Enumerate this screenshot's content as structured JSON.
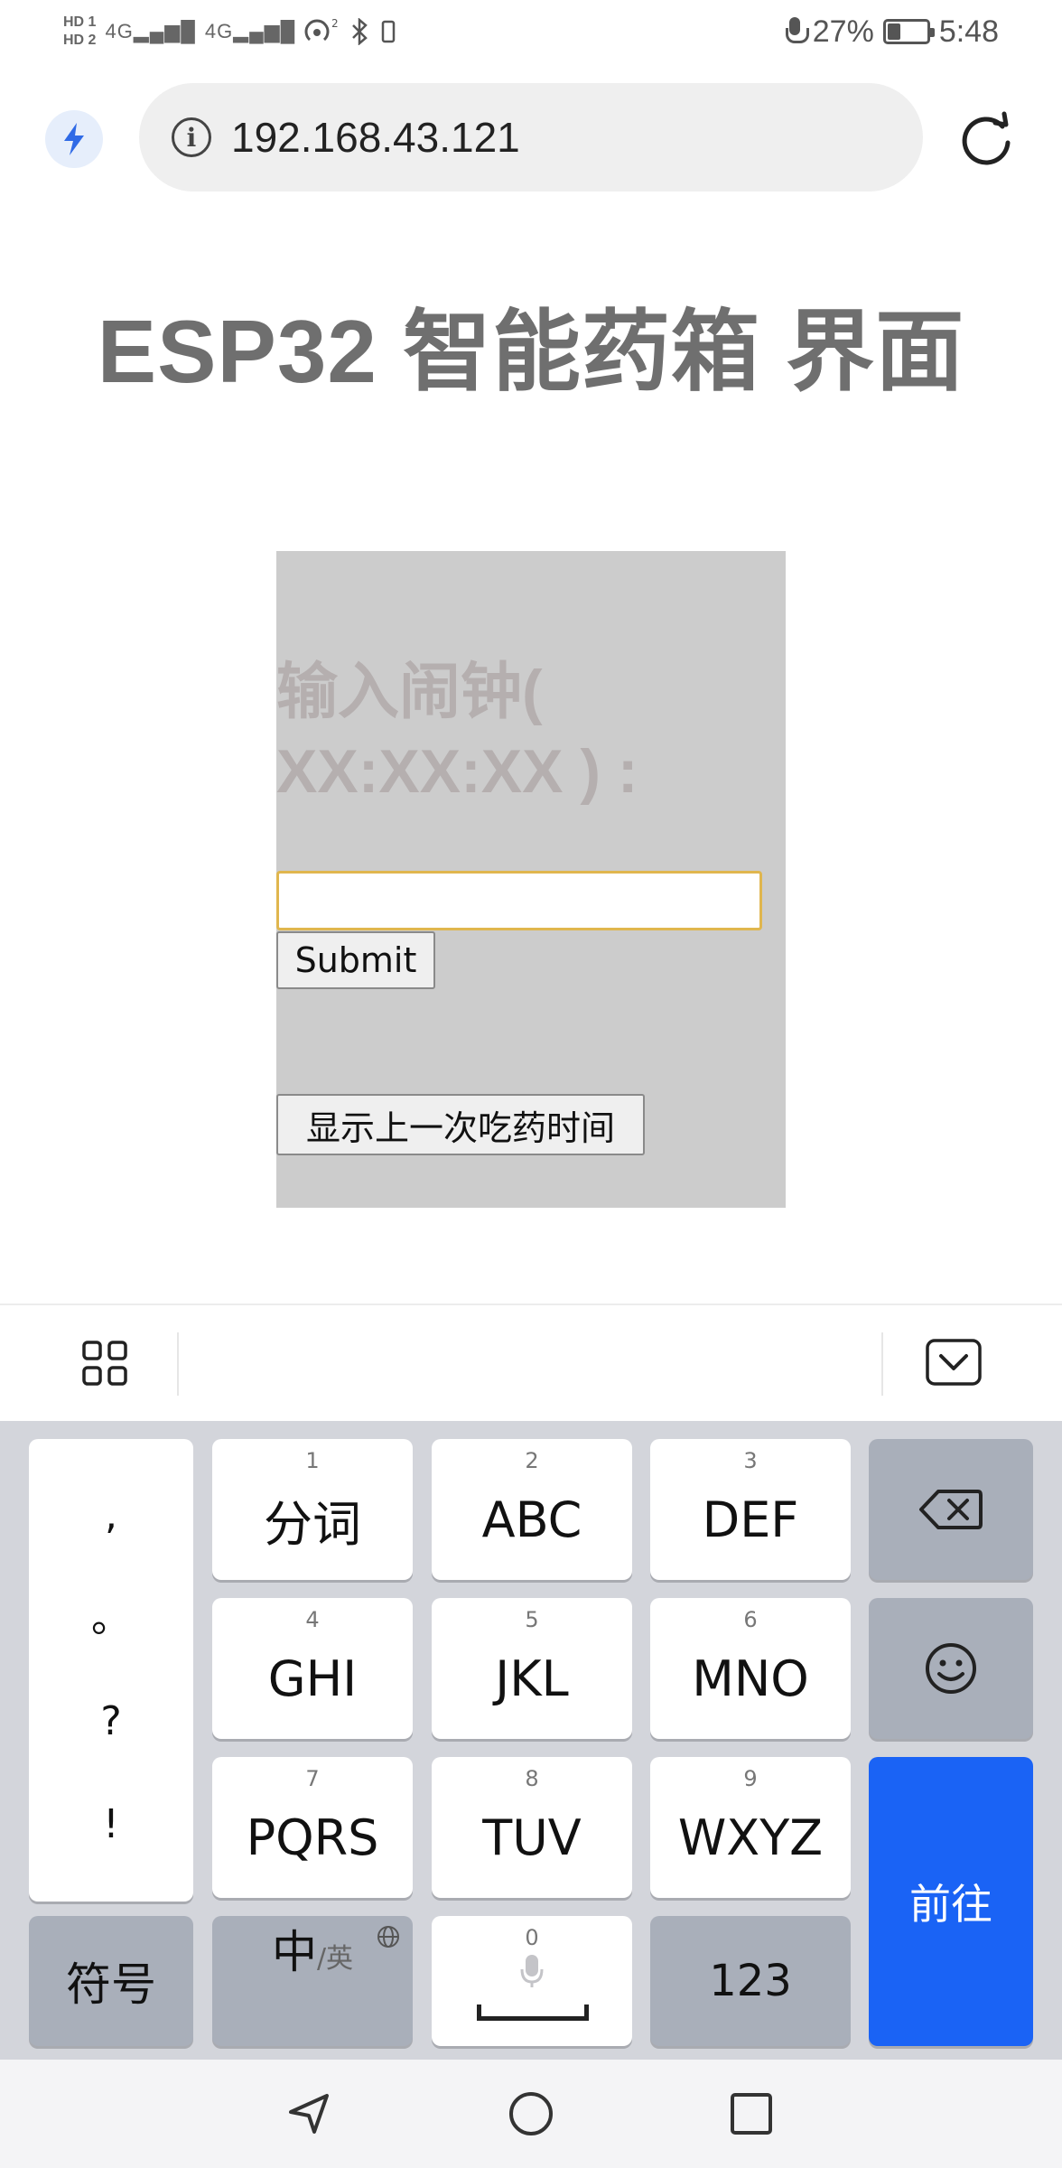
{
  "status_bar": {
    "hd1": "HD 1",
    "hd2": "HD 2",
    "signal1": "4G",
    "signal2": "4G",
    "battery": "27%",
    "time": "5:48"
  },
  "browser": {
    "url": "192.168.43.121"
  },
  "page": {
    "title": "ESP32 智能药箱 界面",
    "alarm_label": "输入闹钟( XX:XX:XX ) :",
    "alarm_input_value": "",
    "submit_label": "Submit",
    "last_taken_label": "显示上一次吃药时间"
  },
  "keyboard": {
    "punct": [
      ",",
      "。",
      "?",
      "!"
    ],
    "row1": [
      {
        "num": "1",
        "label": "分词"
      },
      {
        "num": "2",
        "label": "ABC"
      },
      {
        "num": "3",
        "label": "DEF"
      }
    ],
    "row2": [
      {
        "num": "4",
        "label": "GHI"
      },
      {
        "num": "5",
        "label": "JKL"
      },
      {
        "num": "6",
        "label": "MNO"
      }
    ],
    "row3": [
      {
        "num": "7",
        "label": "PQRS"
      },
      {
        "num": "8",
        "label": "TUV"
      },
      {
        "num": "9",
        "label": "WXYZ"
      }
    ],
    "symbols_label": "符号",
    "lang_main": "中",
    "lang_sub": "/英",
    "space_num": "0",
    "numbers_label": "123",
    "go_label": "前往",
    "accent_color": "#1a63f5"
  },
  "icons": {
    "bolt": "lightning-icon",
    "info": "info-icon",
    "reload": "reload-icon",
    "apps": "grid-icon",
    "hide_keyboard": "keyboard-hide-icon",
    "backspace": "backspace-icon",
    "emoji": "emoji-icon",
    "mic": "microphone-icon",
    "globe": "globe-icon",
    "back": "back-triangle-icon",
    "home": "home-circle-icon",
    "recents": "recents-square-icon"
  }
}
